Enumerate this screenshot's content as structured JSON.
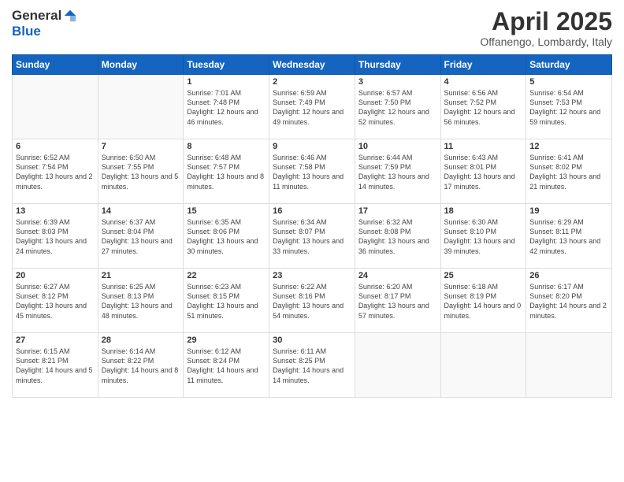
{
  "header": {
    "logo_general": "General",
    "logo_blue": "Blue",
    "month_title": "April 2025",
    "location": "Offanengo, Lombardy, Italy"
  },
  "calendar": {
    "weekdays": [
      "Sunday",
      "Monday",
      "Tuesday",
      "Wednesday",
      "Thursday",
      "Friday",
      "Saturday"
    ],
    "weeks": [
      [
        {
          "day": "",
          "info": ""
        },
        {
          "day": "",
          "info": ""
        },
        {
          "day": "1",
          "info": "Sunrise: 7:01 AM\nSunset: 7:48 PM\nDaylight: 12 hours and 46 minutes."
        },
        {
          "day": "2",
          "info": "Sunrise: 6:59 AM\nSunset: 7:49 PM\nDaylight: 12 hours and 49 minutes."
        },
        {
          "day": "3",
          "info": "Sunrise: 6:57 AM\nSunset: 7:50 PM\nDaylight: 12 hours and 52 minutes."
        },
        {
          "day": "4",
          "info": "Sunrise: 6:56 AM\nSunset: 7:52 PM\nDaylight: 12 hours and 56 minutes."
        },
        {
          "day": "5",
          "info": "Sunrise: 6:54 AM\nSunset: 7:53 PM\nDaylight: 12 hours and 59 minutes."
        }
      ],
      [
        {
          "day": "6",
          "info": "Sunrise: 6:52 AM\nSunset: 7:54 PM\nDaylight: 13 hours and 2 minutes."
        },
        {
          "day": "7",
          "info": "Sunrise: 6:50 AM\nSunset: 7:55 PM\nDaylight: 13 hours and 5 minutes."
        },
        {
          "day": "8",
          "info": "Sunrise: 6:48 AM\nSunset: 7:57 PM\nDaylight: 13 hours and 8 minutes."
        },
        {
          "day": "9",
          "info": "Sunrise: 6:46 AM\nSunset: 7:58 PM\nDaylight: 13 hours and 11 minutes."
        },
        {
          "day": "10",
          "info": "Sunrise: 6:44 AM\nSunset: 7:59 PM\nDaylight: 13 hours and 14 minutes."
        },
        {
          "day": "11",
          "info": "Sunrise: 6:43 AM\nSunset: 8:01 PM\nDaylight: 13 hours and 17 minutes."
        },
        {
          "day": "12",
          "info": "Sunrise: 6:41 AM\nSunset: 8:02 PM\nDaylight: 13 hours and 21 minutes."
        }
      ],
      [
        {
          "day": "13",
          "info": "Sunrise: 6:39 AM\nSunset: 8:03 PM\nDaylight: 13 hours and 24 minutes."
        },
        {
          "day": "14",
          "info": "Sunrise: 6:37 AM\nSunset: 8:04 PM\nDaylight: 13 hours and 27 minutes."
        },
        {
          "day": "15",
          "info": "Sunrise: 6:35 AM\nSunset: 8:06 PM\nDaylight: 13 hours and 30 minutes."
        },
        {
          "day": "16",
          "info": "Sunrise: 6:34 AM\nSunset: 8:07 PM\nDaylight: 13 hours and 33 minutes."
        },
        {
          "day": "17",
          "info": "Sunrise: 6:32 AM\nSunset: 8:08 PM\nDaylight: 13 hours and 36 minutes."
        },
        {
          "day": "18",
          "info": "Sunrise: 6:30 AM\nSunset: 8:10 PM\nDaylight: 13 hours and 39 minutes."
        },
        {
          "day": "19",
          "info": "Sunrise: 6:29 AM\nSunset: 8:11 PM\nDaylight: 13 hours and 42 minutes."
        }
      ],
      [
        {
          "day": "20",
          "info": "Sunrise: 6:27 AM\nSunset: 8:12 PM\nDaylight: 13 hours and 45 minutes."
        },
        {
          "day": "21",
          "info": "Sunrise: 6:25 AM\nSunset: 8:13 PM\nDaylight: 13 hours and 48 minutes."
        },
        {
          "day": "22",
          "info": "Sunrise: 6:23 AM\nSunset: 8:15 PM\nDaylight: 13 hours and 51 minutes."
        },
        {
          "day": "23",
          "info": "Sunrise: 6:22 AM\nSunset: 8:16 PM\nDaylight: 13 hours and 54 minutes."
        },
        {
          "day": "24",
          "info": "Sunrise: 6:20 AM\nSunset: 8:17 PM\nDaylight: 13 hours and 57 minutes."
        },
        {
          "day": "25",
          "info": "Sunrise: 6:18 AM\nSunset: 8:19 PM\nDaylight: 14 hours and 0 minutes."
        },
        {
          "day": "26",
          "info": "Sunrise: 6:17 AM\nSunset: 8:20 PM\nDaylight: 14 hours and 2 minutes."
        }
      ],
      [
        {
          "day": "27",
          "info": "Sunrise: 6:15 AM\nSunset: 8:21 PM\nDaylight: 14 hours and 5 minutes."
        },
        {
          "day": "28",
          "info": "Sunrise: 6:14 AM\nSunset: 8:22 PM\nDaylight: 14 hours and 8 minutes."
        },
        {
          "day": "29",
          "info": "Sunrise: 6:12 AM\nSunset: 8:24 PM\nDaylight: 14 hours and 11 minutes."
        },
        {
          "day": "30",
          "info": "Sunrise: 6:11 AM\nSunset: 8:25 PM\nDaylight: 14 hours and 14 minutes."
        },
        {
          "day": "",
          "info": ""
        },
        {
          "day": "",
          "info": ""
        },
        {
          "day": "",
          "info": ""
        }
      ]
    ]
  }
}
